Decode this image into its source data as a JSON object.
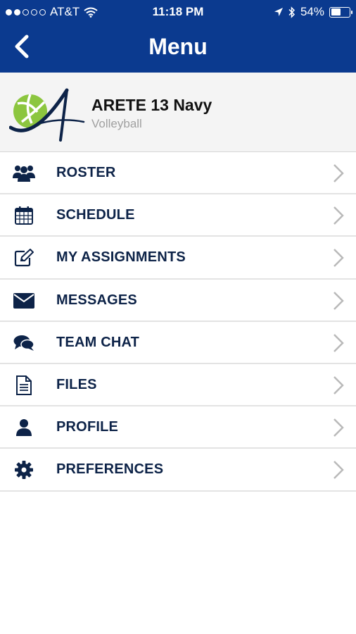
{
  "status_bar": {
    "carrier": "AT&T",
    "time": "11:18 PM",
    "battery": "54%",
    "battery_level": 0.54
  },
  "nav": {
    "title": "Menu"
  },
  "team": {
    "name": "ARETE 13 Navy",
    "sport": "Volleyball"
  },
  "menu": {
    "items": [
      {
        "label": "ROSTER",
        "icon": "users-icon"
      },
      {
        "label": "SCHEDULE",
        "icon": "calendar-icon"
      },
      {
        "label": "MY ASSIGNMENTS",
        "icon": "edit-icon"
      },
      {
        "label": "MESSAGES",
        "icon": "envelope-icon"
      },
      {
        "label": "TEAM CHAT",
        "icon": "chat-bubbles-icon"
      },
      {
        "label": "FILES",
        "icon": "file-icon"
      },
      {
        "label": "PROFILE",
        "icon": "user-icon"
      },
      {
        "label": "PREFERENCES",
        "icon": "gear-icon"
      }
    ]
  },
  "colors": {
    "nav_bar": "#0b3a8f",
    "menu_text": "#0d2348",
    "logo_green": "#8cc63f",
    "logo_navy": "#0d2348"
  }
}
